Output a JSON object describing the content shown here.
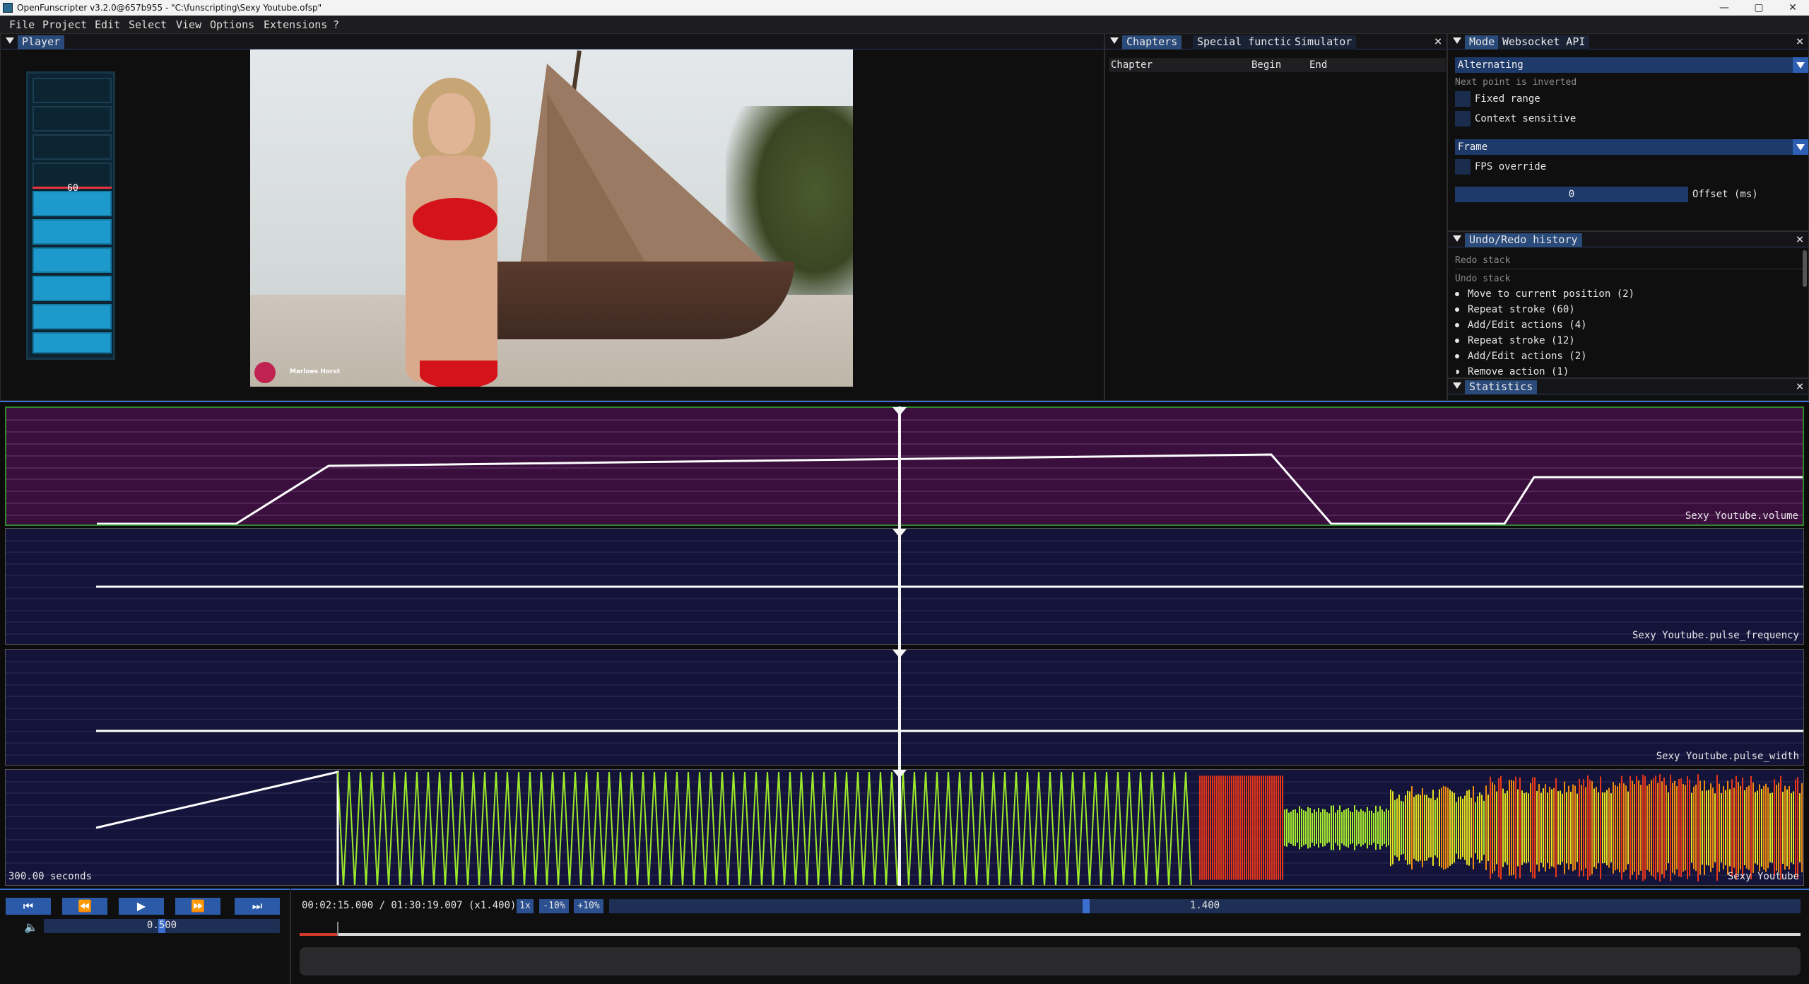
{
  "window": {
    "title": "OpenFunscripter v3.2.0@657b955 - \"C:\\funscripting\\Sexy Youtube.ofsp\"",
    "minimize": "—",
    "maximize": "▢",
    "close": "✕"
  },
  "menu": [
    "File",
    "Project",
    "Edit",
    "Select",
    "View",
    "Options",
    "Extensions",
    "?"
  ],
  "player": {
    "tab": "Player",
    "stroke_level": "60",
    "stroke_fraction": 0.6,
    "watermark": "Marloes Horst"
  },
  "chapters": {
    "tabs": [
      "Chapters",
      "Special functions",
      "Simulator"
    ],
    "columns": [
      "Chapter",
      "Begin",
      "End"
    ]
  },
  "mode": {
    "tabs": [
      "Mode",
      "Websocket API"
    ],
    "mode_select": "Alternating",
    "next_point_text": "Next point is inverted",
    "fixed_range": "Fixed range",
    "context_sensitive": "Context sensitive",
    "frame_select": "Frame",
    "fps_override": "FPS override",
    "offset_value": "0",
    "offset_label": "Offset (ms)"
  },
  "undo": {
    "tab": "Undo/Redo history",
    "redo_stack": "Redo stack",
    "undo_stack": "Undo stack",
    "items": [
      "Move to current position (2)",
      "Repeat stroke (60)",
      "Add/Edit actions (4)",
      "Repeat stroke (12)",
      "Add/Edit actions (2)",
      "Remove action (1)"
    ]
  },
  "statistics": {
    "tab": "Statistics"
  },
  "tracks": [
    {
      "label": "Sexy Youtube.volume"
    },
    {
      "label": "Sexy Youtube.pulse_frequency"
    },
    {
      "label": "Sexy Youtube.pulse_width"
    },
    {
      "label": "Sexy Youtube",
      "window_label": "300.00 seconds"
    }
  ],
  "playback": {
    "time": "00:02:15.000 / 01:30:19.007 (x1.400)",
    "speed_buttons": [
      "1x",
      "-10%",
      "+10%"
    ],
    "speed_value": "1.400",
    "speed_fraction": 0.4,
    "volume": "0.500",
    "volume_fraction": 0.5,
    "progress_fraction": 0.025
  },
  "colors": {
    "accent": "#2b5aa8",
    "volume_track_bg": "#3a0f3e",
    "track_bg": "#14143a",
    "playhead": "#f5f5f5",
    "stroke_fill": "#1d9acb",
    "level_line": "#e8343a"
  }
}
